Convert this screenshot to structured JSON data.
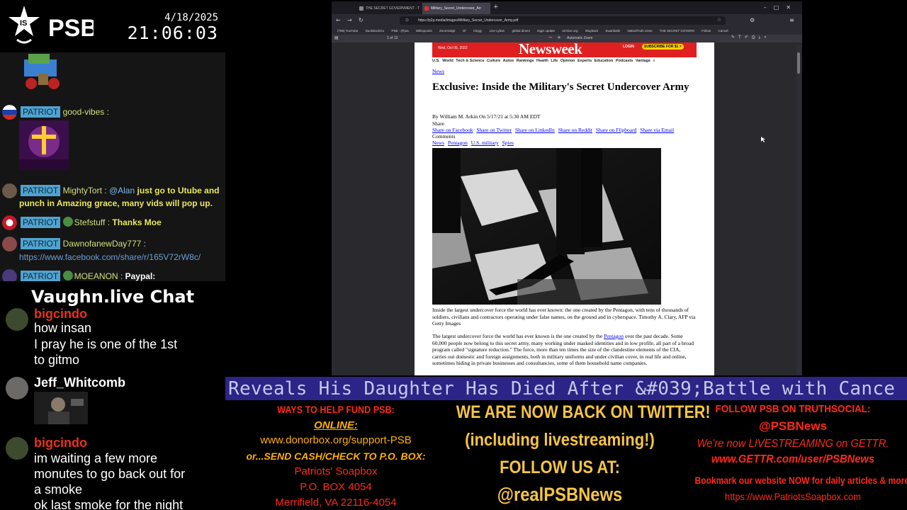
{
  "header": {
    "logo_text": "PSB",
    "date": "4/18/2025",
    "time": "21:06:03"
  },
  "chat1": {
    "badge": "PATRIOT",
    "messages": [
      {
        "user": "good-vibes",
        "text": ""
      },
      {
        "user": "MightyTort",
        "mention": "@Alan",
        "line1": "just go to Utube and",
        "line2": "punch in Amazing grace, many vids will pop up."
      },
      {
        "user": "Stefstuff",
        "text": "Thanks Moe"
      },
      {
        "user": "DawnofanewDay777",
        "link": "https://www.facebook.com/share/r/165V72rW8c/"
      },
      {
        "user": "MOEANON",
        "text": "Paypal:"
      }
    ]
  },
  "vaughn": {
    "title": "Vaughn.live Chat",
    "messages": [
      {
        "user": "bigcindo",
        "lines": [
          "how insan",
          "I pray he is one of the 1st",
          "to gitmo"
        ]
      },
      {
        "user": "Jeff_Whitcomb",
        "lines": []
      },
      {
        "user": "bigcindo",
        "lines": [
          "im waiting a few more",
          "monutes to go back out for",
          "a smoke",
          "ok last smoke for the night"
        ]
      }
    ]
  },
  "browser": {
    "tabs": [
      "THE SECRET GOVERNMENT - T",
      "Military_Secret_Undercover_Arr"
    ],
    "url": "https://p2p.media/images/Military_Secret_Undercover_Army.pdf",
    "bookmarks": [
      "(796) YouTube",
      "DuckDuckGo",
      "PSB - (R)ea",
      "Wikispooks",
      "ZeroHedge",
      "Gf",
      "Citygy",
      "Live Lyban",
      "global dimmi",
      "ingpr update",
      "archive.org",
      "Wayback",
      "Swanbaile",
      "NakedTruth news",
      "THE SECRET GOVERN",
      "Follow",
      "Cancel"
    ],
    "page_indicator": "1 of 13",
    "zoom": "Automatic Zoom"
  },
  "article": {
    "date": "Wed, Oct 05, 2022",
    "masthead": "Newsweek",
    "login": "LOGIN",
    "subscribe": "SUBSCRIBE FOR $1 >",
    "nav": [
      "U.S.",
      "World",
      "Tech & Science",
      "Culture",
      "Autos",
      "Rankings",
      "Health",
      "Life",
      "Opinion",
      "Experts",
      "Education",
      "Podcasts",
      "Vantage"
    ],
    "section": "News",
    "title": "Exclusive: Inside the Military's Secret Undercover Army",
    "byline": "By William M. Arkin On 5/17/21 at 5:30 AM EDT",
    "share_label": "Share",
    "share_links": [
      "Share on Facebook",
      "Share on Twitter",
      "Share on LinkedIn",
      "Share on Reddit",
      "Share on Flipboard",
      "Share via Email"
    ],
    "comments": "Comments",
    "tags": [
      "News",
      "Pentagon",
      "U.S. military",
      "Spies"
    ],
    "caption": "Inside the largest undercover force the world has ever known: the one created by the Pentagon, with tens of thousands of soldiers, civilians and contractors operating under false names, on the ground and in cyberspace. Timothy A. Clary, AFP via Getty Images",
    "body_before": "The largest undercover force the world has ever known is the one created by the ",
    "body_link": "Pentagon",
    "body_after": " over the past decade. Some 60,000 people now belong to this secret army, many working under masked identities and in low profile, all part of a broad program called \"signature reduction.\" The force, more than ten times the size of the clandestine elements of the CIA, carries out domestic and foreign assignments, both in military uniforms and under civilian cover, in real life and online, sometimes hiding in private businesses and consultancies, some of them household name companies."
  },
  "ticker": {
    "text": "Reveals His Daughter Has Died After &#039;Battle with Cance"
  },
  "panels": {
    "help": {
      "l1": "WAYS TO HELP FUND PSB:",
      "l2": "ONLINE:",
      "l3": "www.donorbox.org/support-PSB",
      "l4": "or...SEND CASH/CHECK TO P.O. BOX:",
      "l5": "Patriots' Soapbox",
      "l6": "P.O. BOX 4054",
      "l7": "Merrifield, VA 22116-4054"
    },
    "twitter": {
      "l1": "WE ARE NOW BACK ON TWITTER!",
      "l2": "(including livestreaming!)",
      "l3": "FOLLOW US AT:",
      "l4": "@realPSBNews"
    },
    "truth": {
      "l1": "FOLLOW PSB ON TRUTHSOCIAL:",
      "l2": "@PSBNews",
      "l3": "We're now LIVESTREAMING on GETTR.",
      "l4": "www.GETTR.com/user/PSBNews",
      "l5": "Bookmark our website NOW for daily articles & more!",
      "l6": "https://www.PatriotsSoapbox.com"
    }
  },
  "colors": {
    "ticker_bg": "#2c2587",
    "newsweek_red": "#e02020",
    "badge_blue": "#4fa3d1"
  }
}
